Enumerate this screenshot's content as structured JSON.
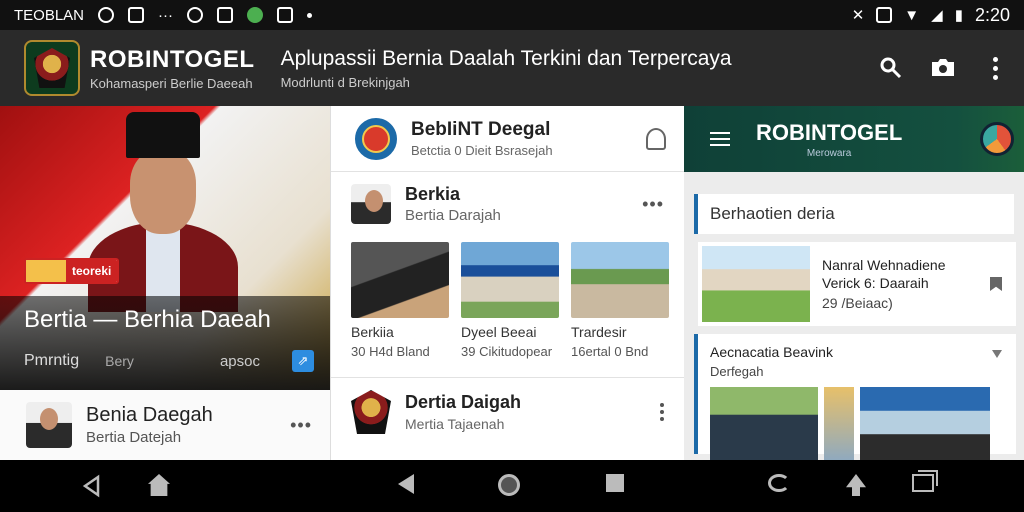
{
  "status_bar": {
    "left_text": "TEOBLAN",
    "icons_left": [
      "whatsapp-icon",
      "image-icon",
      "dots-icon",
      "messenger-icon",
      "calendar-icon",
      "green-app-icon",
      "tools-icon",
      "dot-icon"
    ],
    "time": "2:20",
    "icons_right": [
      "mute-icon",
      "nfc-icon",
      "wifi-icon",
      "signal-icon",
      "battery-icon"
    ]
  },
  "app_bar": {
    "brand_title": "ROBINTOGEL",
    "brand_subtitle": "Kohamasperi Berlie Daeeah",
    "headline": "Aplupassii Bernia Daalah Terkini dan Terpercaya",
    "subheadline": "Modrlunti d Brekinjgah",
    "actions": [
      "search-icon",
      "camera-icon",
      "more-vert-icon"
    ]
  },
  "left_panel": {
    "hero": {
      "badge_text": "teoreki",
      "title": "Bertia — Berhia Daeah",
      "meta_left": "Pmrntig",
      "meta_mid": "Bery",
      "meta_right": "apsoc"
    },
    "item": {
      "title": "Benia Daegah",
      "subtitle": "Bertia Datejah",
      "more": "•••"
    }
  },
  "middle_panel": {
    "header": {
      "title": "BebIiNT Deegal",
      "subtitle": "Betctia 0 Dieit Bsrasejah"
    },
    "post": {
      "title": "Berkia",
      "subtitle": "Bertia Darajah",
      "more": "•••",
      "thumbs": [
        {
          "caption": "Berkiia",
          "sub": "30 H4d Bland"
        },
        {
          "caption": "Dyeel Beeai",
          "sub": "39 Cikitudopear"
        },
        {
          "caption": "Trardesir",
          "sub": "16ertal 0 Bnd"
        }
      ]
    },
    "item": {
      "title": "Dertia Daigah",
      "subtitle": "Mertia Tajaenah"
    }
  },
  "right_panel": {
    "header": {
      "title": "ROBINTOGEL",
      "subtitle": "Merowara"
    },
    "section_title": "Berhaotien deria",
    "card1": {
      "line1": "Nanral Wehnadiene",
      "line2": "Verick 6: Daaraih",
      "line3": "29 /Beiaac)"
    },
    "card2": {
      "title": "Aecnacatia Beavink",
      "subtitle": "Derfegah"
    }
  },
  "nav_bar": {
    "icons": [
      "back-icon",
      "home-icon",
      "back-icon",
      "home-circle-icon",
      "recents-icon",
      "rotate-icon",
      "up-icon",
      "overview-icon"
    ]
  }
}
